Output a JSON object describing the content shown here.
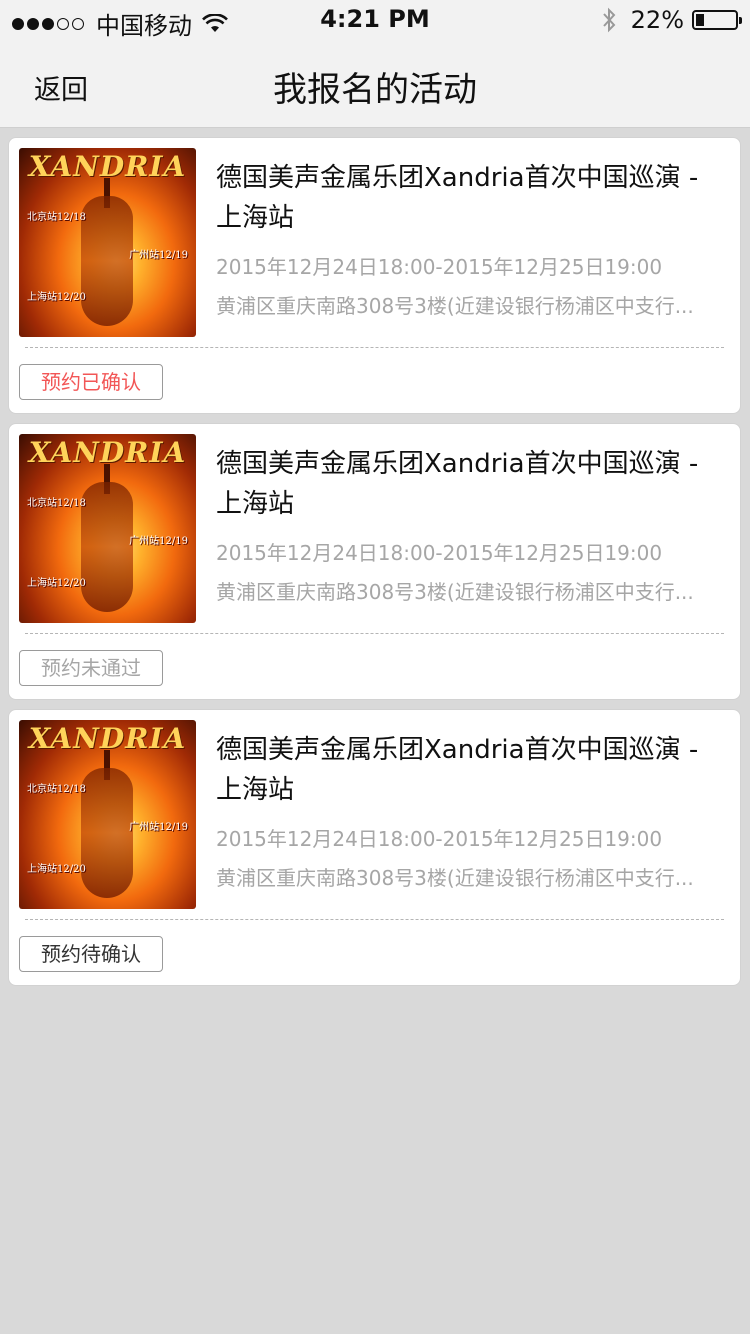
{
  "status_bar": {
    "carrier": "中国移动",
    "time": "4:21 PM",
    "battery_text": "22%",
    "battery_level": 0.22
  },
  "nav": {
    "back_label": "返回",
    "title": "我报名的活动"
  },
  "events": [
    {
      "poster_brand": "XANDRIA",
      "poster_tags": [
        "北京站12/18",
        "广州站12/19",
        "上海站12/20"
      ],
      "title": "德国美声金属乐团Xandria首次中国巡演 - 上海站",
      "time": "2015年12月24日18:00-2015年12月25日19:00",
      "address": "黄浦区重庆南路308号3楼(近建设银行杨浦区中支行...",
      "status_label": "预约已确认",
      "status_color": "#f25656"
    },
    {
      "poster_brand": "XANDRIA",
      "poster_tags": [
        "北京站12/18",
        "广州站12/19",
        "上海站12/20"
      ],
      "title": "德国美声金属乐团Xandria首次中国巡演 - 上海站",
      "time": "2015年12月24日18:00-2015年12月25日19:00",
      "address": "黄浦区重庆南路308号3楼(近建设银行杨浦区中支行...",
      "status_label": "预约未通过",
      "status_color": "#a6a6a6"
    },
    {
      "poster_brand": "XANDRIA",
      "poster_tags": [
        "北京站12/18",
        "广州站12/19",
        "上海站12/20"
      ],
      "title": "德国美声金属乐团Xandria首次中国巡演 - 上海站",
      "time": "2015年12月24日18:00-2015年12月25日19:00",
      "address": "黄浦区重庆南路308号3楼(近建设银行杨浦区中支行...",
      "status_label": "预约待确认",
      "status_color": "#333333"
    }
  ]
}
